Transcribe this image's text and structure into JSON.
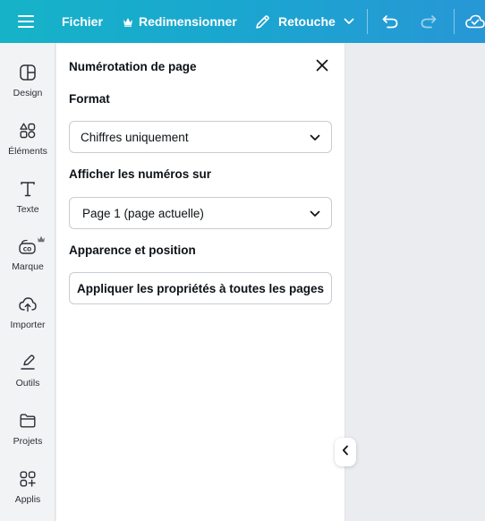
{
  "topbar": {
    "menu_icon": "hamburger-menu-icon",
    "file_label": "Fichier",
    "resize_label": "Redimensionner",
    "resize_icon": "crown-icon",
    "edit_label": "Retouche",
    "edit_icon": "pencil-icon",
    "undo_icon": "undo-icon",
    "redo_icon": "redo-icon",
    "cloud_icon": "cloud-check-icon"
  },
  "sidebar": {
    "items": [
      {
        "label": "Design",
        "icon": "layout-icon"
      },
      {
        "label": "Éléments",
        "icon": "shapes-icon"
      },
      {
        "label": "Texte",
        "icon": "text-icon"
      },
      {
        "label": "Marque",
        "icon": "brand-kit-icon"
      },
      {
        "label": "Importer",
        "icon": "cloud-upload-icon"
      },
      {
        "label": "Outils",
        "icon": "draw-tool-icon"
      },
      {
        "label": "Projets",
        "icon": "folder-icon"
      },
      {
        "label": "Applis",
        "icon": "apps-icon"
      }
    ]
  },
  "panel": {
    "title": "Numérotation de page",
    "format": {
      "label": "Format",
      "value": "Chiffres uniquement"
    },
    "show_on": {
      "label": "Afficher les numéros sur",
      "value": "Page 1 (page actuelle)"
    },
    "appearance": {
      "label": "Apparence et position",
      "apply_button": "Appliquer les propriétés à toutes les pages"
    }
  },
  "colors": {
    "topbar_start": "#16b3c8",
    "topbar_end": "#2797d6",
    "rail_bg": "#f2f3f5",
    "canvas_bg": "#ebecf0"
  }
}
